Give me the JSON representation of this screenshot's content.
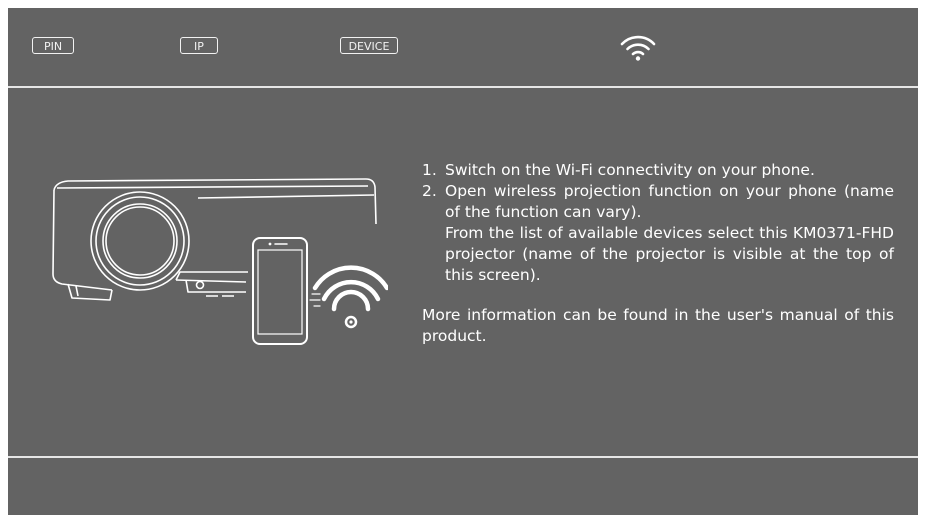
{
  "topbar": {
    "pin_label": "PIN",
    "ip_label": "IP",
    "device_label": "DEVICE",
    "wifi_icon": "wifi-icon"
  },
  "instructions": {
    "step1_number": "1.",
    "step1_text": "Switch on the Wi-Fi connectivity on your phone.",
    "step2_number": "2.",
    "step2_text_a": "Open wireless projection function on your phone (name of the function can vary).",
    "step2_text_b": "From the list of available devices select this KM0371-FHD projector (name of the projector is visible at the top of this screen).",
    "more_info": "More information can be found in the user's manual of this product."
  },
  "illustration": {
    "projector_icon": "projector-icon",
    "phone_icon": "smartphone-icon",
    "wifi_icon": "wifi-signal-icon"
  },
  "colors": {
    "background": "#636363",
    "divider": "#e6e6e6",
    "text": "#ffffff"
  }
}
